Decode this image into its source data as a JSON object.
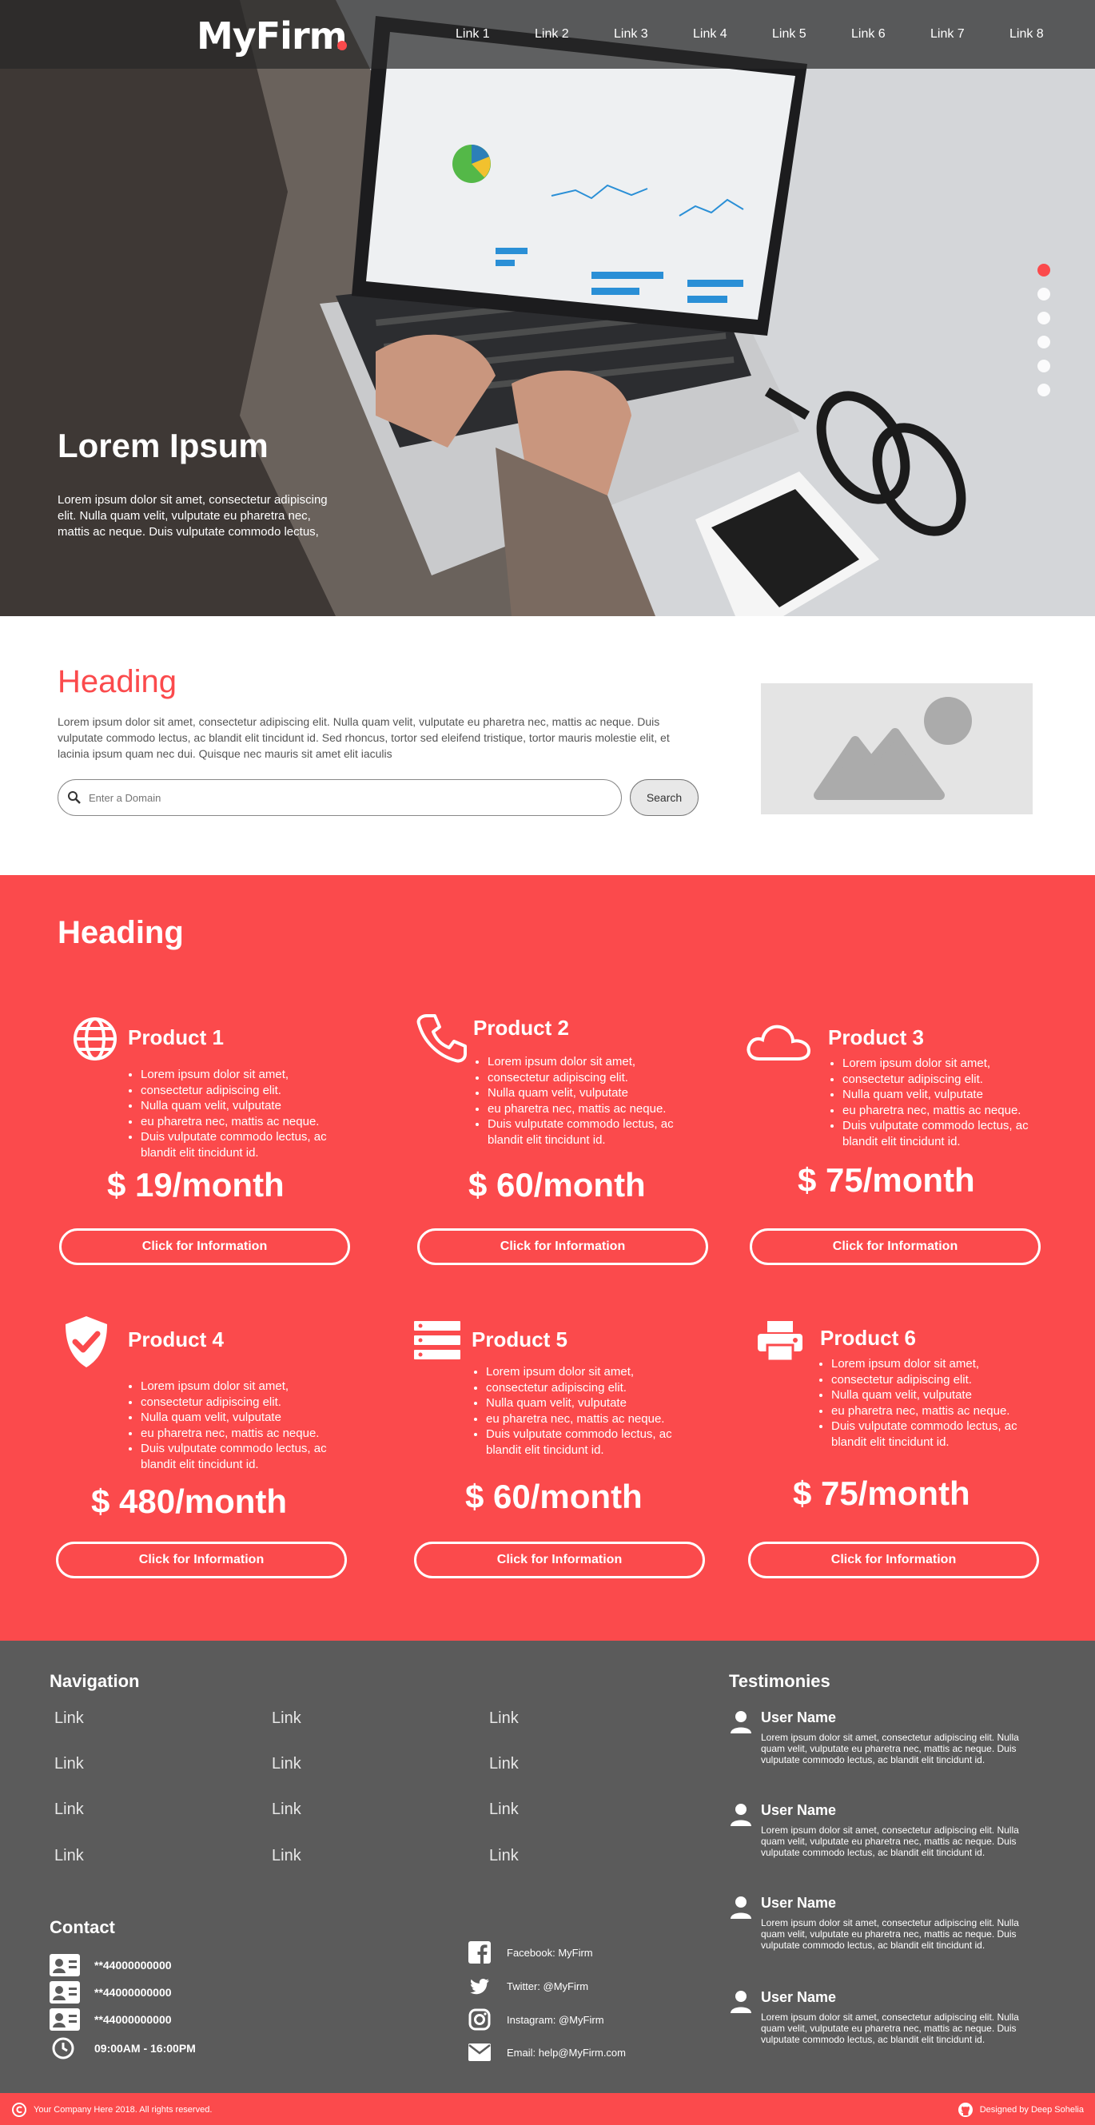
{
  "brand": {
    "name": "MyFirm",
    "accent": "#fb4a4c",
    "footer_bg": "#5b5b5b"
  },
  "nav": {
    "links": [
      "Link 1",
      "Link 2",
      "Link 3",
      "Link 4",
      "Link 5",
      "Link 6",
      "Link 7",
      "Link 8"
    ]
  },
  "hero": {
    "title": "Lorem Ipsum",
    "text": "Lorem ipsum dolor sit amet, consectetur adipiscing elit. Nulla quam velit, vulputate eu pharetra nec, mattis ac neque. Duis vulputate commodo lectus,",
    "slides": 6,
    "active_slide": 1
  },
  "intro": {
    "heading": "Heading",
    "text": "Lorem ipsum dolor sit amet, consectetur adipiscing elit. Nulla quam velit, vulputate eu pharetra nec, mattis ac neque. Duis vulputate commodo lectus, ac blandit elit tincidunt id. Sed rhoncus, tortor sed eleifend tristique, tortor mauris molestie elit, et lacinia ipsum quam nec dui. Quisque nec mauris sit amet elit iaculis",
    "search_placeholder": "Enter a Domain",
    "search_button": "Search"
  },
  "products": {
    "heading": "Heading",
    "features": [
      "Lorem ipsum dolor sit amet,",
      "consectetur adipiscing elit.",
      "Nulla quam velit, vulputate",
      "eu pharetra nec, mattis ac neque.",
      "Duis vulputate commodo lectus, ac blandit elit tincidunt id."
    ],
    "button_label": "Click for Information",
    "items": [
      {
        "name": "Product 1",
        "price": "$ 19/month",
        "icon": "globe-icon"
      },
      {
        "name": "Product 2",
        "price": "$ 60/month",
        "icon": "phone-icon"
      },
      {
        "name": "Product 3",
        "price": "$ 75/month",
        "icon": "cloud-icon"
      },
      {
        "name": "Product 4",
        "price": "$ 480/month",
        "icon": "shield-check-icon"
      },
      {
        "name": "Product 5",
        "price": "$ 60/month",
        "icon": "server-icon"
      },
      {
        "name": "Product 6",
        "price": "$ 75/month",
        "icon": "printer-icon"
      }
    ]
  },
  "footer": {
    "navigation_title": "Navigation",
    "nav_link": "Link",
    "contact_title": "Contact",
    "contacts": [
      "**44000000000",
      "**44000000000",
      "**44000000000",
      "09:00AM - 16:00PM"
    ],
    "social": [
      "Facebook: MyFirm",
      "Twitter: @MyFirm",
      "Instagram: @MyFirm",
      "Email: help@MyFirm.com"
    ],
    "testimonies_title": "Testimonies",
    "testimonies": [
      {
        "user": "User Name",
        "text": "Lorem ipsum dolor sit amet, consectetur adipiscing elit. Nulla quam velit, vulputate eu pharetra nec, mattis ac neque. Duis vulputate commodo lectus, ac blandit elit tincidunt id."
      },
      {
        "user": "User Name",
        "text": "Lorem ipsum dolor sit amet, consectetur adipiscing elit. Nulla quam velit, vulputate eu pharetra nec, mattis ac neque. Duis vulputate commodo lectus, ac blandit elit tincidunt id."
      },
      {
        "user": "User Name",
        "text": "Lorem ipsum dolor sit amet, consectetur adipiscing elit. Nulla quam velit, vulputate eu pharetra nec, mattis ac neque. Duis vulputate commodo lectus, ac blandit elit tincidunt id."
      },
      {
        "user": "User Name",
        "text": "Lorem ipsum dolor sit amet, consectetur adipiscing elit. Nulla quam velit, vulputate eu pharetra nec, mattis ac neque. Duis vulputate commodo lectus, ac blandit elit tincidunt id."
      }
    ],
    "copyright": "Your Company Here 2018. All rights reserved.",
    "designer": "Designed by Deep Sohelia"
  }
}
